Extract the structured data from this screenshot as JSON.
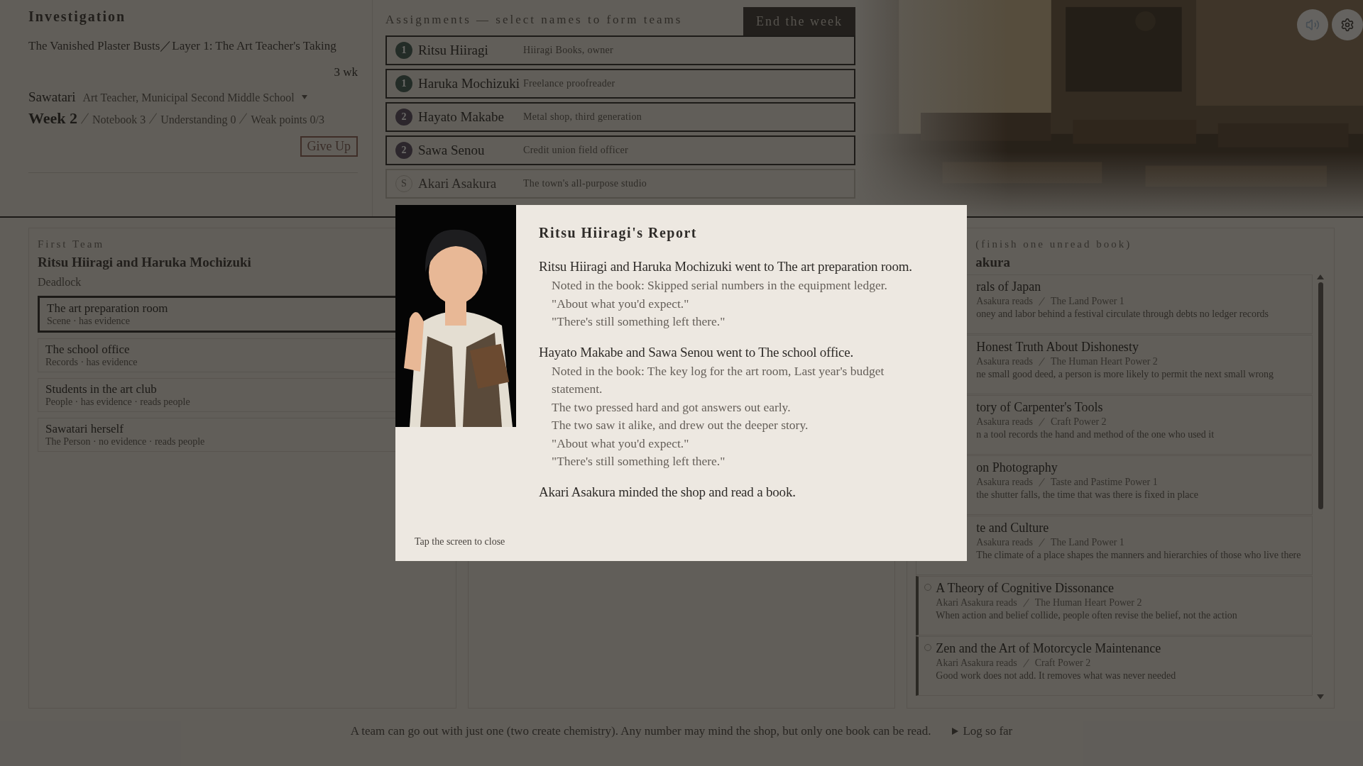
{
  "investigation": {
    "title": "Investigation",
    "case": "The Vanished Plaster Busts／Layer 1: The Art Teacher's Taking",
    "time_left": "3 wk",
    "suspect": {
      "name": "Sawatari",
      "role": "Art Teacher, Municipal Second Middle School",
      "expanded": false
    },
    "week": "Week 2",
    "stats": [
      "Notebook 3",
      "Understanding 0",
      "Weak points 0/3"
    ],
    "give_up": "Give Up"
  },
  "assignments": {
    "label": "Assignments — select names to form teams",
    "end_week": "End the week",
    "rows": [
      {
        "kind": "first",
        "badge": "1",
        "name": "Ritsu Hiiragi",
        "note": "Hiiragi Books, owner"
      },
      {
        "kind": "first",
        "badge": "1",
        "name": "Haruka Mochizuki",
        "note": "Freelance proofreader"
      },
      {
        "kind": "second",
        "badge": "2",
        "name": "Hayato Makabe",
        "note": "Metal shop, third generation"
      },
      {
        "kind": "second",
        "badge": "2",
        "name": "Sawa Senou",
        "note": "Credit union field officer"
      },
      {
        "kind": "shop",
        "badge": "S",
        "name": "Akari Asakura",
        "note": "The town's all-purpose studio"
      }
    ]
  },
  "first_team": {
    "label": "First Team",
    "members": "Ritsu Hiiragi and Haruka Mochizuki",
    "status": "Deadlock",
    "places": [
      {
        "name": "The art preparation room",
        "detail": "Scene · has evidence",
        "selected": true
      },
      {
        "name": "The school office",
        "detail": "Records · has evidence",
        "selected": false
      },
      {
        "name": "Students in the art club",
        "detail": "People · has evidence · reads people",
        "selected": false
      },
      {
        "name": "Sawatari herself",
        "detail": "The Person · no evidence · reads people",
        "selected": false
      }
    ]
  },
  "shop": {
    "label": "(finish one unread book)",
    "member": "akura",
    "books": [
      {
        "kind": "covered",
        "title": "rals of Japan",
        "reader": "Asakura reads",
        "power": "The Land Power 1",
        "summary": "oney and labor behind a festival circulate through debts no ledger records"
      },
      {
        "kind": "covered",
        "title": "Honest Truth About Dishonesty",
        "reader": "Asakura reads",
        "power": "The Human Heart Power 2",
        "summary": "ne small good deed, a person is more likely to permit the next small wrong"
      },
      {
        "kind": "covered",
        "title": "tory of Carpenter's Tools",
        "reader": "Asakura reads",
        "power": "Craft Power 2",
        "summary": "n a tool records the hand and method of the one who used it"
      },
      {
        "kind": "covered",
        "title": "on Photography",
        "reader": "Asakura reads",
        "power": "Taste and Pastime Power 1",
        "summary": "the shutter falls, the time that was there is fixed in place"
      },
      {
        "kind": "covered",
        "title": "te and Culture",
        "reader": "Asakura reads",
        "power": "The Land Power 1",
        "summary": "The climate of a place shapes the manners and hierarchies of those who live there"
      },
      {
        "kind": "open",
        "selected": false,
        "title": "A Theory of Cognitive Dissonance",
        "reader": "Akari Asakura reads",
        "power": "The Human Heart Power 2",
        "summary": "When action and belief collide, people often revise the belief, not the action"
      },
      {
        "kind": "open",
        "selected": false,
        "title": "Zen and the Art of Motorcycle Maintenance",
        "reader": "Akari Asakura reads",
        "power": "Craft Power 2",
        "summary": "Good work does not add. It removes what was never needed"
      }
    ]
  },
  "footer": {
    "hint": "A team can go out with just one (two create chemistry). Any number may mind the shop, but only one book can be read.",
    "log": {
      "label": "Log so far",
      "expanded": false
    }
  },
  "report": {
    "title": "Ritsu Hiiragi's Report",
    "sections": [
      {
        "lead": "Ritsu Hiiragi and Haruka Mochizuki went to The art preparation room.",
        "lines": [
          "Noted in the book: Skipped serial numbers in the equipment ledger.",
          "\"About what you'd expect.\"",
          "\"There's still something left there.\""
        ]
      },
      {
        "lead": "Hayato Makabe and Sawa Senou went to The school office.",
        "lines": [
          "Noted in the book: The key log for the art room, Last year's budget statement.",
          "The two pressed hard and got answers out early.",
          "The two saw it alike, and drew out the deeper story.",
          "\"About what you'd expect.\"",
          "\"There's still something left there.\""
        ]
      },
      {
        "lead": "Akari Asakura minded the shop and read a book."
      }
    ],
    "close_hint": "Tap the screen to close"
  }
}
